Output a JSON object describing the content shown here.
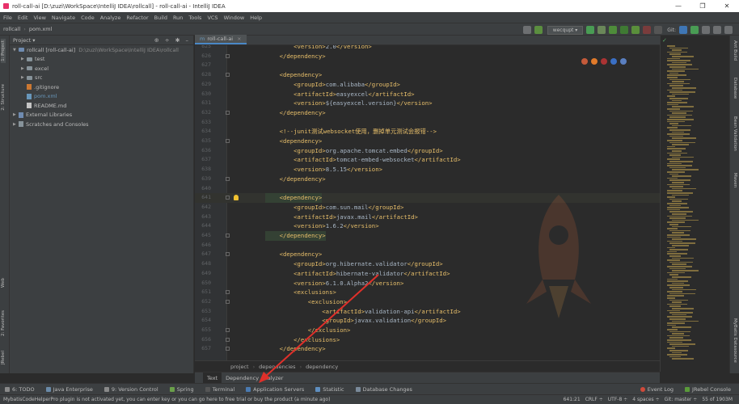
{
  "window": {
    "title": "roll-call-ai [D:\\zuzi\\WorkSpace\\IntelliJ IDEA\\rollcall] - roll-call-ai - IntelliJ IDEA",
    "min": "—",
    "max": "❐",
    "close": "✕"
  },
  "menu": [
    "File",
    "Edit",
    "View",
    "Navigate",
    "Code",
    "Analyze",
    "Refactor",
    "Build",
    "Run",
    "Tools",
    "VCS",
    "Window",
    "Help"
  ],
  "navbar": {
    "project": "rollcall",
    "file": "pom.xml",
    "run_config": "wecqupt ▾",
    "git_label": "Git:"
  },
  "project_panel": {
    "header": "Project ▾",
    "tree": [
      {
        "label": "rollcall [roll-call-ai]",
        "path": "D:\\zuzi\\WorkSpace\\IntelliJ IDEA\\rollcall",
        "indent": 0,
        "arrow": "▼",
        "icon": "folder"
      },
      {
        "label": "test",
        "indent": 1,
        "arrow": "▶",
        "icon": "folder"
      },
      {
        "label": "excel",
        "indent": 1,
        "arrow": "▶",
        "icon": "folder"
      },
      {
        "label": "src",
        "indent": 1,
        "arrow": "▶",
        "icon": "folder"
      },
      {
        "label": ".gitignore",
        "indent": 1,
        "arrow": "",
        "icon": "git-file"
      },
      {
        "label": "pom.xml",
        "indent": 1,
        "arrow": "",
        "icon": "maven-file"
      },
      {
        "label": "README.md",
        "indent": 1,
        "arrow": "",
        "icon": "md-file"
      },
      {
        "label": "External Libraries",
        "indent": 0,
        "arrow": "▶",
        "icon": "lib"
      },
      {
        "label": "Scratches and Consoles",
        "indent": 0,
        "arrow": "▶",
        "icon": "scratch"
      }
    ]
  },
  "left_tabs": [
    "1: Project",
    "2: Structure",
    "Web",
    "2: Favorites",
    "JRebel"
  ],
  "right_tabs": [
    "Ant Build",
    "Database",
    "Bean Validation",
    "Maven",
    "MyBatis Datasource"
  ],
  "editor": {
    "tab_label": "roll-call-ai",
    "lines": [
      {
        "n": "625",
        "code": "        <version>2.0</version>"
      },
      {
        "n": "626",
        "code": "    </dependency>"
      },
      {
        "n": "627",
        "code": ""
      },
      {
        "n": "628",
        "code": "    <dependency>"
      },
      {
        "n": "629",
        "code": "        <groupId>com.alibaba</groupId>"
      },
      {
        "n": "630",
        "code": "        <artifactId>easyexcel</artifactId>"
      },
      {
        "n": "631",
        "code": "        <version>${easyexcel.version}</version>"
      },
      {
        "n": "632",
        "code": "    </dependency>"
      },
      {
        "n": "633",
        "code": ""
      },
      {
        "n": "634",
        "code": "    <!--junit测试websocket使用，删掉单元测试会报错-->"
      },
      {
        "n": "635",
        "code": "    <dependency>"
      },
      {
        "n": "636",
        "code": "        <groupId>org.apache.tomcat.embed</groupId>"
      },
      {
        "n": "637",
        "code": "        <artifactId>tomcat-embed-websocket</artifactId>"
      },
      {
        "n": "638",
        "code": "        <version>8.5.15</version>"
      },
      {
        "n": "639",
        "code": "    </dependency>"
      },
      {
        "n": "640",
        "code": ""
      },
      {
        "n": "641",
        "code": "    <dependency>"
      },
      {
        "n": "642",
        "code": "        <groupId>com.sun.mail</groupId>"
      },
      {
        "n": "643",
        "code": "        <artifactId>javax.mail</artifactId>"
      },
      {
        "n": "644",
        "code": "        <version>1.6.2</version>"
      },
      {
        "n": "645",
        "code": "    </dependency>"
      },
      {
        "n": "646",
        "code": ""
      },
      {
        "n": "647",
        "code": "    <dependency>"
      },
      {
        "n": "648",
        "code": "        <groupId>org.hibernate.validator</groupId>"
      },
      {
        "n": "649",
        "code": "        <artifactId>hibernate-validator</artifactId>"
      },
      {
        "n": "650",
        "code": "        <version>6.1.0.Alpha2</version>"
      },
      {
        "n": "651",
        "code": "        <exclusions>"
      },
      {
        "n": "652",
        "code": "            <exclusion>"
      },
      {
        "n": "653",
        "code": "                <artifactId>validation-api</artifactId>"
      },
      {
        "n": "654",
        "code": "                <groupId>javax.validation</groupId>"
      },
      {
        "n": "655",
        "code": "            </exclusion>"
      },
      {
        "n": "656",
        "code": "        </exclusions>"
      },
      {
        "n": "657",
        "code": "    </dependency>"
      }
    ],
    "breadcrumbs": [
      "project",
      "dependencies",
      "dependency"
    ],
    "bottom_tabs": [
      "Text",
      "Dependency Analyzer"
    ]
  },
  "tool_windows_left": [
    "6: TODO",
    "Java Enterprise",
    "9: Version Control",
    "Spring",
    "Terminal",
    "Application Servers",
    "Statistic",
    "Database Changes"
  ],
  "tool_windows_right": [
    "Event Log",
    "JRebel Console"
  ],
  "status": {
    "message": "MybatisCodeHelperPro plugin is not activated yet, you can enter key or you can go here to free trial or buy the product (a minute ago)",
    "position": "641:21",
    "line_sep": "CRLF ÷",
    "encoding": "UTF-8 ÷",
    "indent": "4 spaces ÷",
    "git": "Git: master ÷",
    "memory": "55 of 1903M"
  },
  "colors": {
    "accent": "#4a88c7",
    "tag": "#e8bf6a",
    "text": "#a9b7c6",
    "comment": "#808080",
    "arrow": "#e0302a"
  }
}
